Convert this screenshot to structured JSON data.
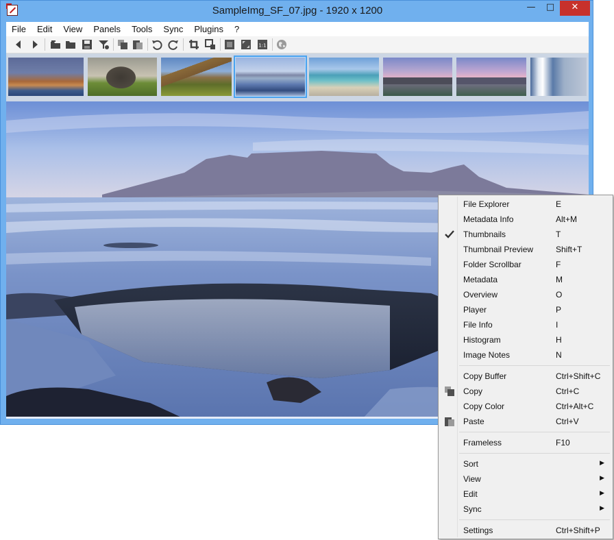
{
  "window": {
    "title": "SampleImg_SF_07.jpg  - 1920 x 1200"
  },
  "menubar": [
    "File",
    "Edit",
    "View",
    "Panels",
    "Tools",
    "Sync",
    "Plugins",
    "?"
  ],
  "toolbar_icons": [
    "back-icon",
    "forward-icon",
    "open-file-icon",
    "open-folder-icon",
    "save-icon",
    "filter-icon",
    "copy-icon",
    "paste-icon",
    "rotate-left-icon",
    "rotate-right-icon",
    "crop-icon",
    "resize-icon",
    "fit-window-icon",
    "fullscreen-icon",
    "actual-size-icon",
    "web-icon"
  ],
  "context_menu": {
    "checked": "Thumbnails",
    "groups": [
      [
        {
          "label": "File Explorer",
          "shortcut": "E"
        },
        {
          "label": "Metadata Info",
          "shortcut": "Alt+M"
        },
        {
          "label": "Thumbnails",
          "shortcut": "T"
        },
        {
          "label": "Thumbnail Preview",
          "shortcut": "Shift+T"
        },
        {
          "label": "Folder Scrollbar",
          "shortcut": "F"
        },
        {
          "label": "Metadata",
          "shortcut": "M"
        },
        {
          "label": "Overview",
          "shortcut": "O"
        },
        {
          "label": "Player",
          "shortcut": "P"
        },
        {
          "label": "File Info",
          "shortcut": "I"
        },
        {
          "label": "Histogram",
          "shortcut": "H"
        },
        {
          "label": "Image Notes",
          "shortcut": "N"
        }
      ],
      [
        {
          "label": "Copy Buffer",
          "shortcut": "Ctrl+Shift+C"
        },
        {
          "label": "Copy",
          "shortcut": "Ctrl+C"
        },
        {
          "label": "Copy Color",
          "shortcut": "Ctrl+Alt+C"
        },
        {
          "label": "Paste",
          "shortcut": "Ctrl+V"
        }
      ],
      [
        {
          "label": "Frameless",
          "shortcut": "F10"
        }
      ],
      [
        {
          "label": "Sort",
          "shortcut": "",
          "submenu": true
        },
        {
          "label": "View",
          "shortcut": "",
          "submenu": true
        },
        {
          "label": "Edit",
          "shortcut": "",
          "submenu": true
        },
        {
          "label": "Sync",
          "shortcut": "",
          "submenu": true
        }
      ],
      [
        {
          "label": "Settings",
          "shortcut": "Ctrl+Shift+P"
        }
      ]
    ]
  },
  "colors": {
    "frame": "#70b0ee",
    "close": "#c7312b",
    "selection": "#4aa3f0"
  }
}
